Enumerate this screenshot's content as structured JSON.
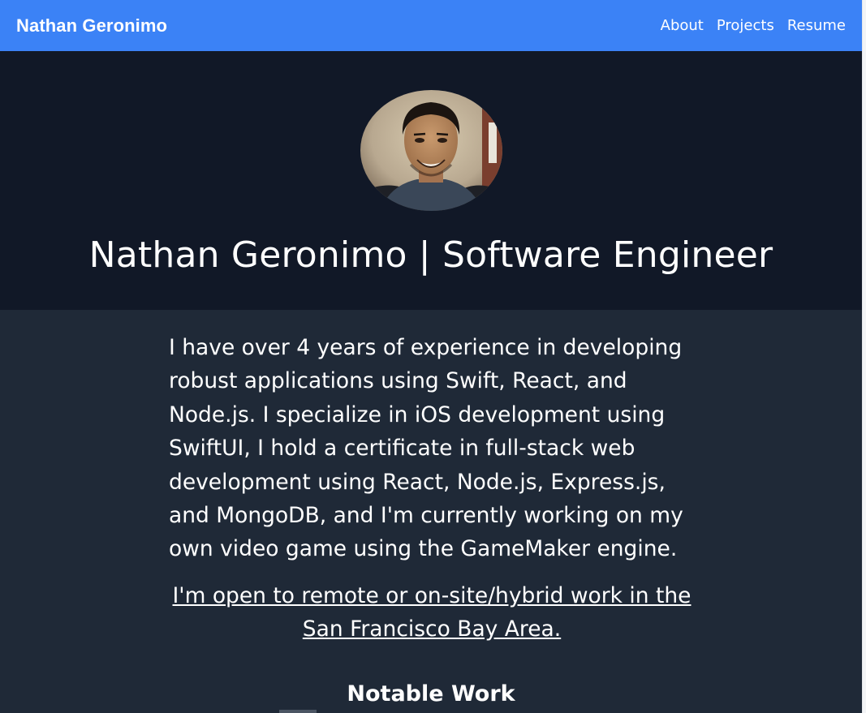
{
  "navbar": {
    "brand": "Nathan Geronimo",
    "links": [
      "About",
      "Projects",
      "Resume"
    ],
    "color": "#3b82f6"
  },
  "hero": {
    "title": "Nathan Geronimo | Software Engineer",
    "background": "#111827"
  },
  "content": {
    "bio": "I have over 4 years of experience in developing robust applications using Swift, React, and Node.js. I specialize in iOS development using SwiftUI, I hold a certificate in full-stack web development using React, Node.js, Express.js, and MongoDB, and I'm currently working on my own video game using the GameMaker engine.",
    "availability": "I'm open to remote or on-site/hybrid work in the San Francisco Bay Area.",
    "section_heading": "Notable Work",
    "background": "#1f2937"
  }
}
